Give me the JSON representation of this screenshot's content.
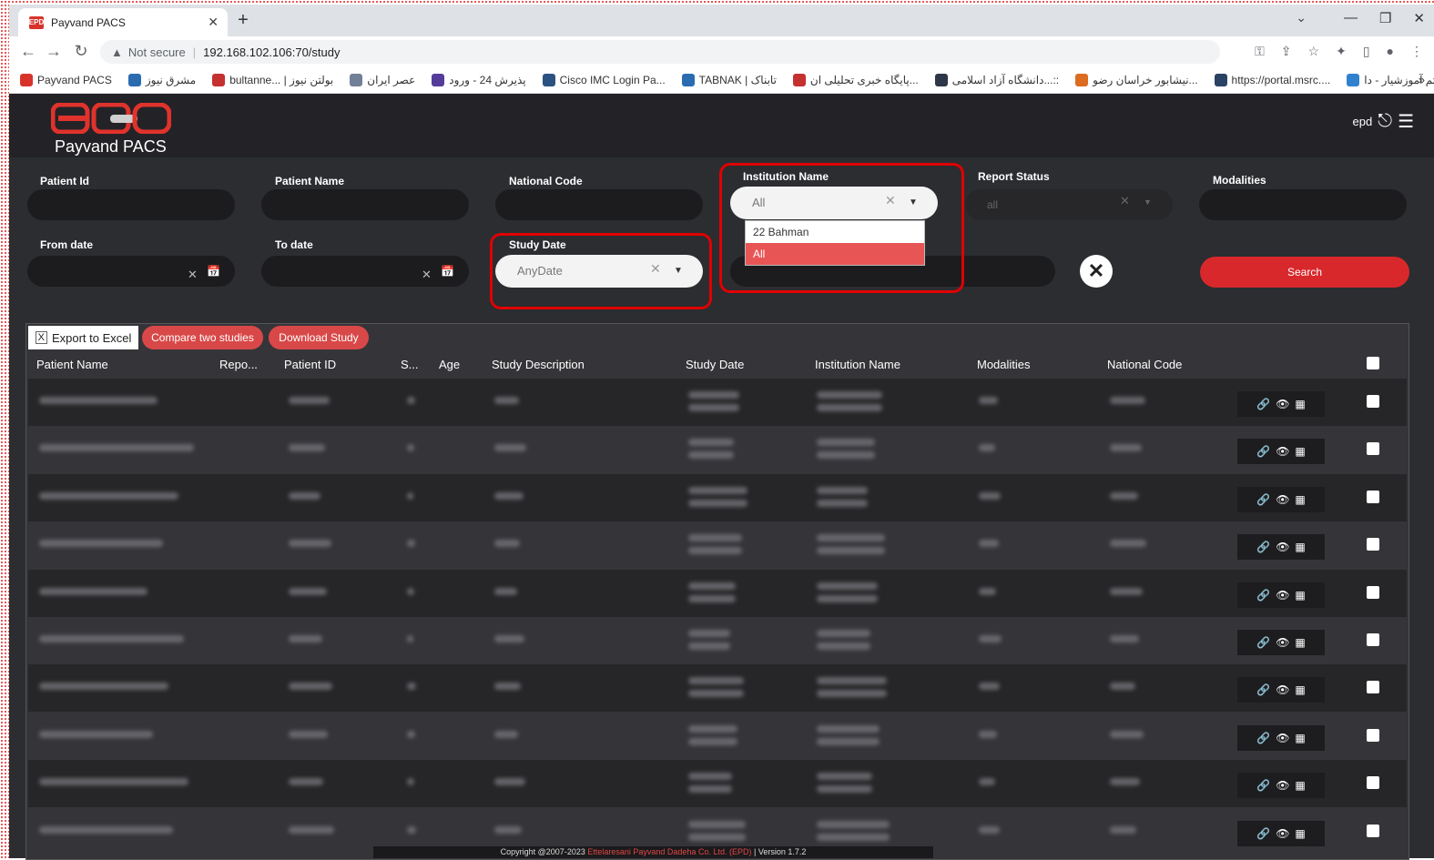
{
  "browser": {
    "tab_title": "Payvand PACS",
    "url": "192.168.102.106:70/study",
    "security_text": "Not secure",
    "bookmarks": [
      {
        "label": "Payvand PACS",
        "color": "#d8332b"
      },
      {
        "label": "مشرق نیوز",
        "color": "#2b6cb0"
      },
      {
        "label": "bultanne... | بولتن نیوز",
        "color": "#c53030"
      },
      {
        "label": "عصر ایران",
        "color": "#718096"
      },
      {
        "label": "پذیرش 24 - ورود",
        "color": "#553c9a"
      },
      {
        "label": "Cisco IMC Login Pa...",
        "color": "#2c5282"
      },
      {
        "label": "TABNAK | تابناک",
        "color": "#2b6cb0"
      },
      {
        "label": "پایگاه خبری تحلیلی ان...",
        "color": "#c53030"
      },
      {
        "label": "دانشگاه آزاد اسلامی...::",
        "color": "#2d3748"
      },
      {
        "label": "نیشابور خراسان رضو...",
        "color": "#dd6b20"
      },
      {
        "label": "https://portal.msrc....",
        "color": "#2a4365"
      },
      {
        "label": "سیستم آموزشیار - دا...",
        "color": "#3182ce"
      }
    ]
  },
  "app": {
    "logo_text": "Payvand PACS",
    "header_right": "epd"
  },
  "filters": {
    "patient_id": "Patient Id",
    "patient_name": "Patient Name",
    "national_code": "National Code",
    "institution_name": "Institution Name",
    "institution_value": "All",
    "institution_options": [
      "22 Bahman",
      "All"
    ],
    "report_status": "Report Status",
    "report_status_value": "all",
    "modalities": "Modalities",
    "from_date": "From date",
    "to_date": "To date",
    "study_date": "Study Date",
    "study_date_value": "AnyDate",
    "search": "Search"
  },
  "table": {
    "buttons": {
      "export": "Export to Excel",
      "compare": "Compare two studies",
      "download": "Download Study"
    },
    "columns": [
      "Patient Name",
      "Repo...",
      "Patient ID",
      "S...",
      "Age",
      "Study Description",
      "Study Date",
      "Institution Name",
      "Modalities",
      "National Code"
    ]
  },
  "footer": {
    "prefix": "Copyright @2007-2023",
    "company": "Ettelaresani Payvand Dadeha Co. Ltd. (EPD)",
    "suffix": "| Version 1.7.2"
  },
  "colors": {
    "accent": "#d8282c",
    "highlight": "#e00000",
    "app_bg": "#2b2d31"
  }
}
